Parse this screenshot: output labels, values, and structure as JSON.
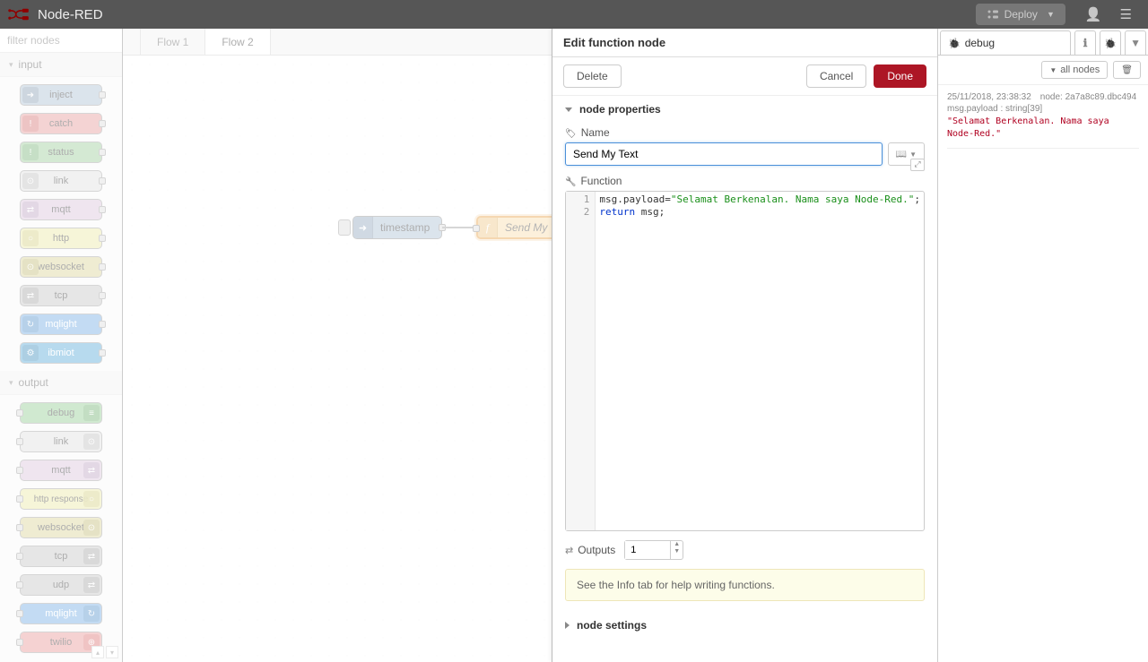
{
  "header": {
    "title": "Node-RED",
    "deploy_label": "Deploy"
  },
  "palette": {
    "search_placeholder": "filter nodes",
    "sections": {
      "input": {
        "label": "input"
      },
      "output": {
        "label": "output"
      }
    },
    "input_nodes": [
      "inject",
      "catch",
      "status",
      "link",
      "mqtt",
      "http",
      "websocket",
      "tcp",
      "mqlight",
      "ibmiot"
    ],
    "output_nodes": [
      "debug",
      "link",
      "mqtt",
      "http response",
      "websocket",
      "tcp",
      "udp",
      "mqlight",
      "twilio"
    ]
  },
  "tabs": [
    {
      "label": "Flow 1",
      "active": false
    },
    {
      "label": "Flow 2",
      "active": true
    }
  ],
  "flow": {
    "inject_label": "timestamp",
    "function_label": "Send My Text"
  },
  "edit": {
    "title": "Edit function node",
    "buttons": {
      "delete": "Delete",
      "cancel": "Cancel",
      "done": "Done"
    },
    "sections": {
      "properties": "node properties",
      "settings": "node settings"
    },
    "name_label": "Name",
    "name_value": "Send My Text",
    "function_label": "Function",
    "code_lines": [
      {
        "n": "1",
        "raw": "msg.payload=\"Selamat Berkenalan. Nama saya Node-Red.\";"
      },
      {
        "n": "2",
        "raw": "return msg;"
      }
    ],
    "code_line1_prefix": "msg.payload=",
    "code_line1_string": "\"Selamat Berkenalan. Nama saya Node-Red.\"",
    "code_line1_suffix": ";",
    "code_line2_kw": "return",
    "code_line2_rest": " msg;",
    "outputs_label": "Outputs",
    "outputs_value": "1",
    "info_text": "See the Info tab for help writing functions."
  },
  "sidebar": {
    "tab_label": "debug",
    "all_nodes_label": "all nodes",
    "debug": {
      "timestamp": "25/11/2018, 23:38:32",
      "node_label": "node:",
      "node_id": "2a7a8c89.dbc494",
      "path": "msg.payload : string[39]",
      "value": "\"Selamat Berkenalan. Nama saya Node-Red.\""
    }
  }
}
